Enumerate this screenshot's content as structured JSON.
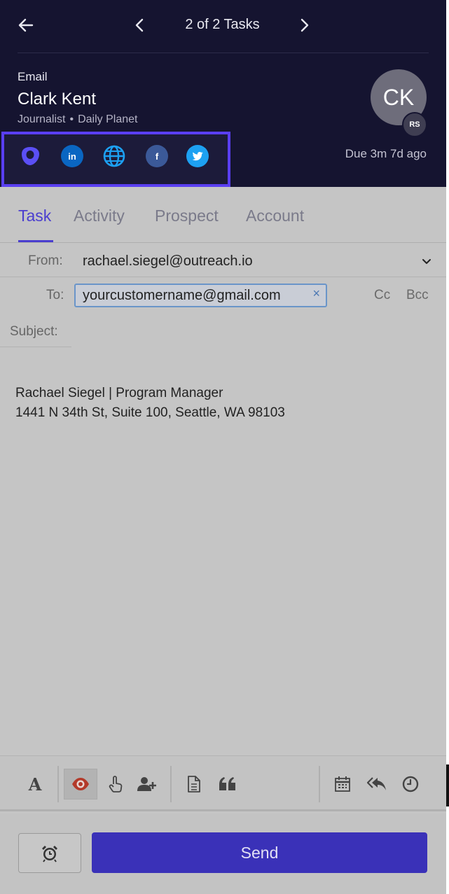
{
  "header": {
    "task_counter": "2 of 2 Tasks",
    "task_type": "Email",
    "contact_name": "Clark Kent",
    "contact_title": "Journalist",
    "contact_company": "Daily Planet",
    "contact_initials": "CK",
    "owner_initials": "RS",
    "due_text": "Due 3m 7d ago",
    "social_icons": [
      "outreach-icon",
      "linkedin-icon",
      "globe-icon",
      "facebook-icon",
      "twitter-icon"
    ],
    "linkedin_label": "in",
    "facebook_label": "f"
  },
  "tabs": [
    {
      "label": "Task",
      "active": true
    },
    {
      "label": "Activity",
      "active": false
    },
    {
      "label": "Prospect",
      "active": false
    },
    {
      "label": "Account",
      "active": false
    }
  ],
  "compose": {
    "from_label": "From:",
    "from_value": "rachael.siegel@outreach.io",
    "to_label": "To:",
    "to_recipient": "yourcustomername@gmail.com",
    "remove_symbol": "×",
    "cc_label": "Cc",
    "bcc_label": "Bcc",
    "subject_label": "Subject:",
    "subject_value": "",
    "body_lines": [
      "Rachael Siegel | Program Manager",
      "1441 N 34th St, Suite 100, Seattle, WA 98103"
    ]
  },
  "toolbar": {
    "items": [
      "font-format-icon",
      "eye-tracking-icon",
      "link-tracking-icon",
      "add-prospect-icon",
      "template-icon",
      "snippet-icon",
      "calendar-icon",
      "reply-all-icon",
      "schedule-icon"
    ],
    "font_glyph": "A"
  },
  "footer": {
    "send_label": "Send"
  },
  "colors": {
    "header_bg": "#151430",
    "accent": "#4a3ecf",
    "highlight_border": "#5a3ff2",
    "send_bg": "#3a31b8",
    "linkedin": "#0a66c2",
    "facebook": "#3b5998",
    "twitter": "#1da1f2",
    "eye_active": "#b33a2a"
  }
}
